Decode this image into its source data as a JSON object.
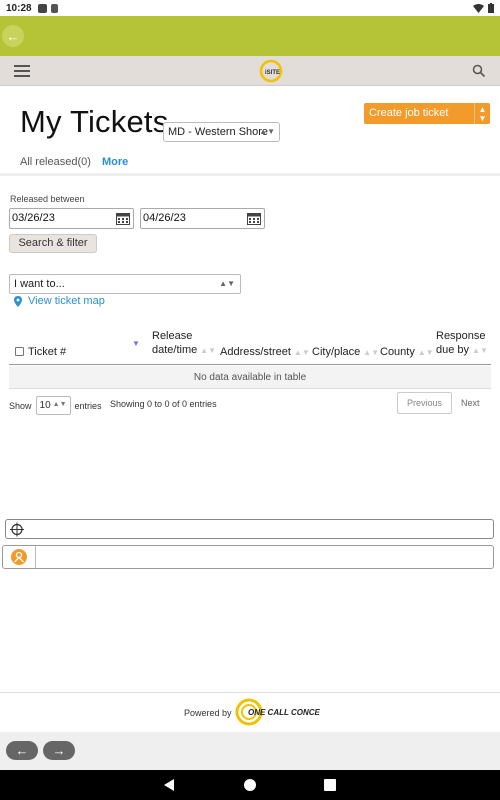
{
  "status_bar": {
    "time": "10:28"
  },
  "header": {
    "logo_text": "iSITE"
  },
  "page": {
    "title": "My Tickets",
    "region_select": "MD - Western Shore",
    "create_button": "Create job ticket",
    "released_label": "All released(0)",
    "more_link": "More"
  },
  "filter": {
    "released_between_label": "Released between",
    "date_from": "03/26/23",
    "date_to": "04/26/23",
    "search_button": "Search & filter",
    "i_want_to": "I want to...",
    "view_map": "View ticket map"
  },
  "table": {
    "columns": [
      "Ticket #",
      "Release date/time",
      "Address/street",
      "City/place",
      "County",
      "Response due by"
    ],
    "col_release_1": "Release",
    "col_release_2": "date/time",
    "col_response_1": "Response",
    "col_response_2": "due by",
    "empty_message": "No data available in table",
    "show_label": "Show",
    "page_size": "10",
    "entries_label": "entries",
    "showing_text": "Showing 0 to 0 of 0 entries",
    "previous": "Previous",
    "next": "Next"
  },
  "footer": {
    "powered_by": "Powered by",
    "brand": "ONE CALL CONCEPTS"
  },
  "colors": {
    "accent_green": "#b5c336",
    "create_orange": "#f29b2a",
    "link_blue": "#2a8fd0"
  }
}
